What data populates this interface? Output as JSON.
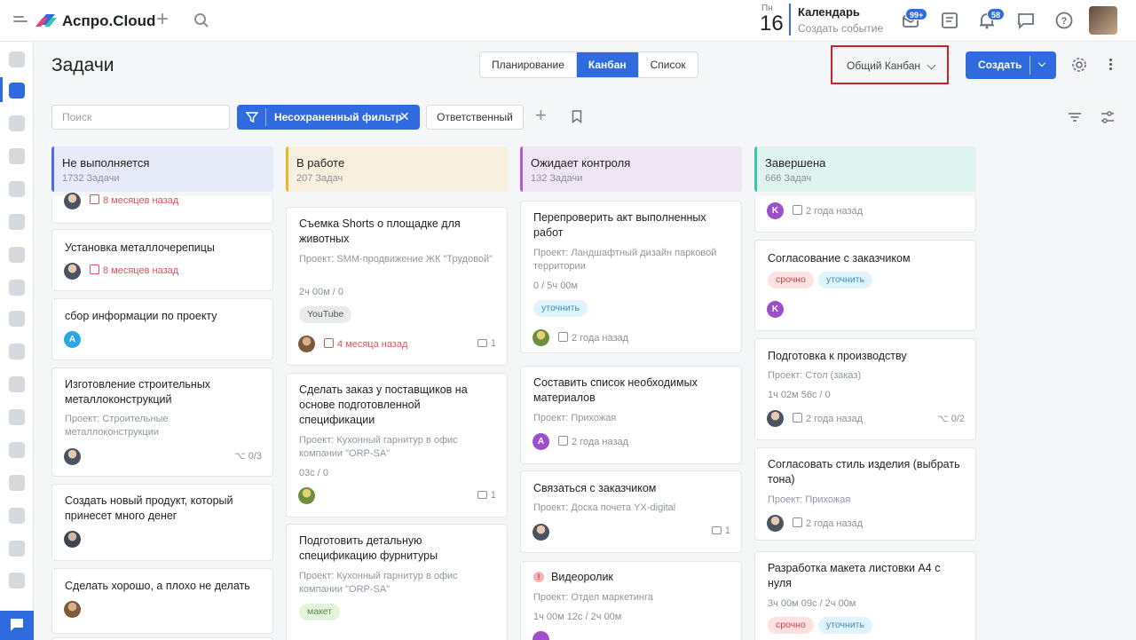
{
  "app": {
    "brand": "Аспро.Cloud"
  },
  "calendar": {
    "weekday": "Пн",
    "day": "16",
    "title": "Календарь",
    "subtitle": "Создать событие"
  },
  "badges": {
    "mail": "99+",
    "notifications": "58"
  },
  "page": {
    "title": "Задачи",
    "views": [
      "Планирование",
      "Канбан",
      "Список"
    ],
    "active_view": "Канбан",
    "kanban_select": "Общий Канбан",
    "create_label": "Создать"
  },
  "filters": {
    "search_placeholder": "Поиск",
    "active_filter": "Несохраненный фильтр",
    "responsible": "Ответственный"
  },
  "columns": [
    {
      "title": "Не выполняется",
      "count": "1732 Задачи",
      "color": "#4a6fdc",
      "bg": "#e6eaf9",
      "cards": [
        {
          "title": "",
          "date": "8 месяцев назад",
          "overdue": true
        },
        {
          "title": "Установка металлочерепицы",
          "date": "8 месяцев назад",
          "overdue": true
        },
        {
          "title": "сбор информации по проекту",
          "avatar": "A"
        },
        {
          "title": "Изготовление строительных металлоконструкций",
          "project": "Проект: Строительные металлоконструкции",
          "subtasks": "0/3"
        },
        {
          "title": "Создать новый продукт, который принесет много денег"
        },
        {
          "title": "Сделать хорошо, а плохо не делать"
        }
      ]
    },
    {
      "title": "В работе",
      "count": "207 Задач",
      "color": "#f0b429",
      "bg": "#f8efde",
      "cards": [
        {
          "title": "Съемка Shorts о площадке для животных",
          "project": "Проект: SMM-продвижение ЖК \"Трудовой\"",
          "time": "2ч 00м / 0",
          "tag": "YouTube",
          "date": "4 месяца назад",
          "overdue": true,
          "comments": "1"
        },
        {
          "title": "Сделать заказ у поставщиков на основе подготовленной спецификации",
          "project": "Проект: Кухонный гарнитур в офис компании \"ORP-SA\"",
          "time": "03с / 0",
          "comments": "1"
        },
        {
          "title": "Подготовить детальную спецификацию фурнитуры",
          "project": "Проект: Кухонный гарнитур в офис компании \"ORP-SA\"",
          "tag": "макет"
        }
      ]
    },
    {
      "title": "Ожидает контроля",
      "count": "132 Задачи",
      "color": "#b05ad3",
      "bg": "#efe5f5",
      "cards": [
        {
          "title": "Перепроверить акт выполненных работ",
          "project": "Проект: Ландшафтный дизайн парковой территории",
          "time": "0 / 5ч 00м",
          "tag": "уточнить",
          "date": "2 года назад"
        },
        {
          "title": "Составить список необходимых материалов",
          "project": "Проект: Прихожая",
          "avatar": "A",
          "date": "2 года назад"
        },
        {
          "title": "Связаться с заказчиком",
          "project": "Проект: Доска почета YX-digital",
          "comments": "1"
        },
        {
          "title": "Видеоролик",
          "project": "Проект: Отдел маркетинга",
          "time": "1ч 00м 12с / 2ч 00м",
          "warning": "!"
        }
      ]
    },
    {
      "title": "Завершена",
      "count": "666 Задач",
      "color": "#3cc4b2",
      "bg": "#dff3ef",
      "cards": [
        {
          "title": "",
          "avatar": "K",
          "date": "2 года назад"
        },
        {
          "title": "Согласование с заказчиком",
          "tags": [
            "срочно",
            "уточнить"
          ],
          "avatar": "K"
        },
        {
          "title": "Подготовка к производству",
          "project": "Проект: Стол (заказ)",
          "time": "1ч 02м 56с / 0",
          "date": "2 года назад",
          "subtasks": "0/2"
        },
        {
          "title": "Согласовать стиль изделия (выбрать тона)",
          "project": "Проект: Прихожая",
          "date": "2 года назад"
        },
        {
          "title": "Разработка макета листовки А4 с нуля",
          "time": "3ч 00м 09с / 2ч 00м",
          "tags": [
            "срочно",
            "уточнить"
          ]
        }
      ]
    }
  ],
  "icons": {
    "menu": "menu-icon",
    "logo": "logo-icon",
    "add": "plus-icon",
    "search": "search-icon",
    "mail": "mail-icon",
    "notes": "notes-icon",
    "bell": "bell-icon",
    "chat": "chat-icon",
    "help": "help-icon",
    "settings": "gear-icon"
  }
}
